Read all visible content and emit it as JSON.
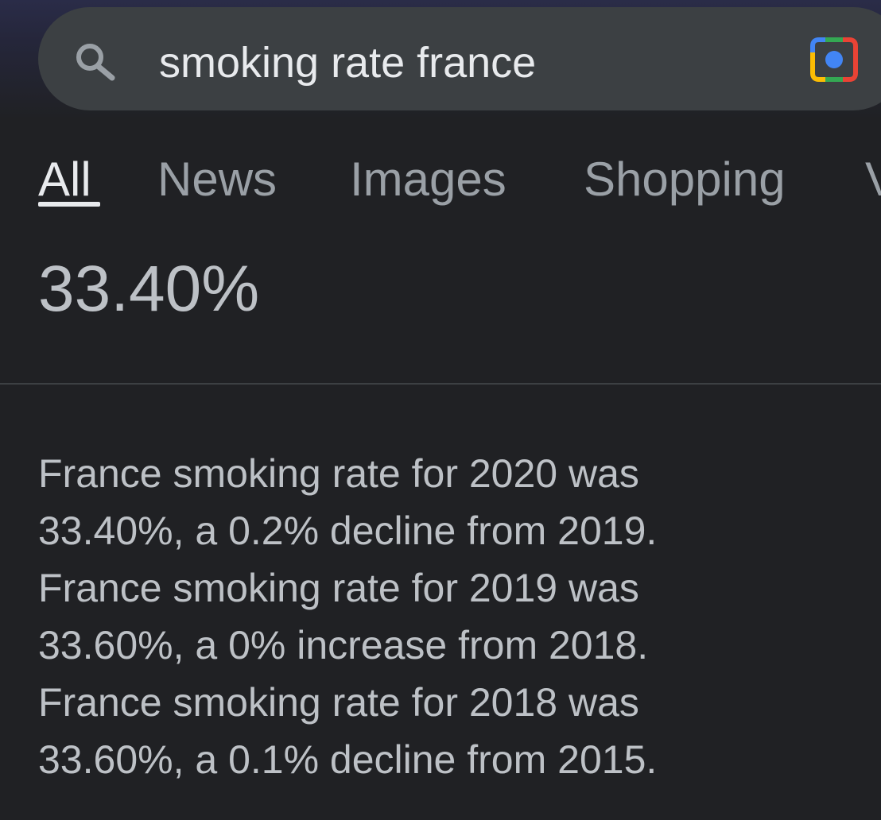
{
  "search": {
    "query": "smoking rate france"
  },
  "tabs": [
    {
      "label": "All",
      "active": true
    },
    {
      "label": "News",
      "active": false
    },
    {
      "label": "Images",
      "active": false
    },
    {
      "label": "Shopping",
      "active": false
    },
    {
      "label": "V",
      "active": false
    }
  ],
  "answer": {
    "value": "33.40%"
  },
  "snippet": {
    "lines": [
      "France smoking rate for 2020 was",
      "33.40%, a 0.2% decline from 2019.",
      "France smoking rate for 2019 was",
      "33.60%, a 0% increase from 2018.",
      "France smoking rate for 2018 was",
      "33.60%, a 0.1% decline from 2015."
    ]
  },
  "icons": {
    "search": "search-icon",
    "lens": "google-lens-icon"
  },
  "colors": {
    "background": "#202124",
    "search_bar": "#3c4043",
    "text_primary": "#e8eaed",
    "text_secondary": "#9aa0a6",
    "text_body": "#bdc1c6",
    "lens_blue": "#4285f4",
    "lens_red": "#ea4335",
    "lens_yellow": "#fbbc04",
    "lens_green": "#34a853"
  }
}
